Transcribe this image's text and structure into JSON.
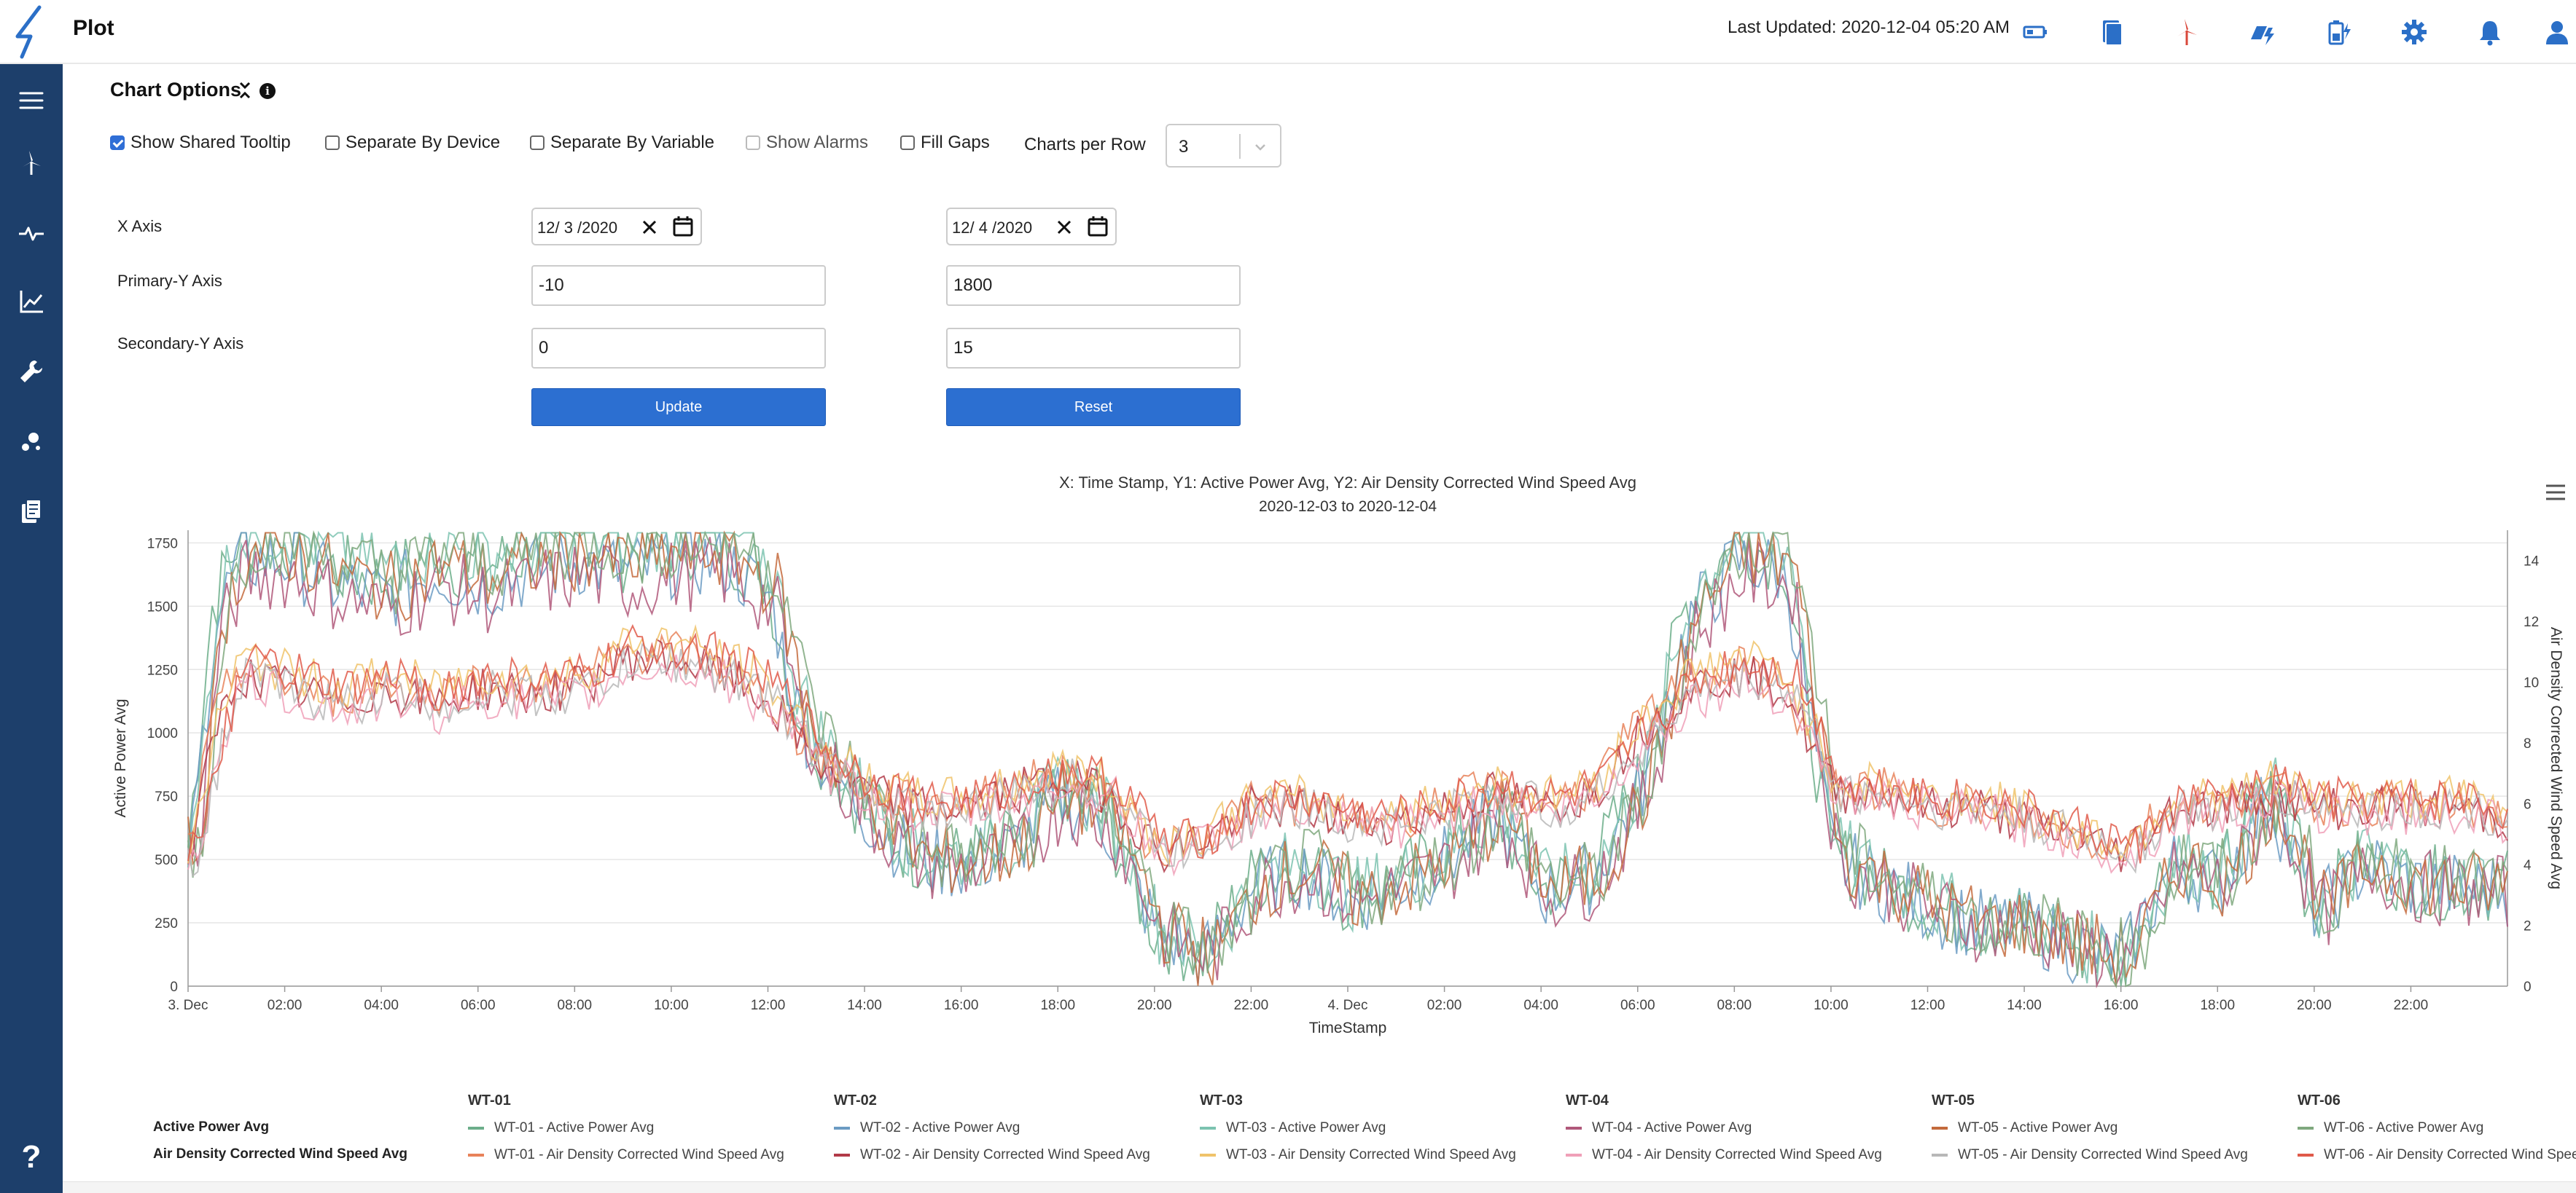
{
  "header": {
    "title": "Plot",
    "last_updated": "Last Updated: 2020-12-04 05:20 AM",
    "icons": [
      "battery-icon",
      "report-icon",
      "wind-turbine-icon",
      "solar-power-icon",
      "battery-charge-icon",
      "gear-icon",
      "bell-icon",
      "user-icon"
    ]
  },
  "sidebar": {
    "icons": [
      "menu-icon",
      "wind-turbine-icon",
      "pulse-icon",
      "line-chart-icon",
      "wrench-icon",
      "scatter-icon",
      "documents-icon"
    ],
    "help": "?"
  },
  "options": {
    "title": "Chart Options",
    "checkboxes": [
      {
        "label": "Show Shared Tooltip",
        "checked": true,
        "disabled": false
      },
      {
        "label": "Separate By Device",
        "checked": false,
        "disabled": false
      },
      {
        "label": "Separate By Variable",
        "checked": false,
        "disabled": false
      },
      {
        "label": "Show Alarms",
        "checked": false,
        "disabled": true
      },
      {
        "label": "Fill Gaps",
        "checked": false,
        "disabled": false
      }
    ],
    "charts_per_row_label": "Charts per Row",
    "charts_per_row_value": "3",
    "x_axis_label": "X Axis",
    "x_axis_start": "12/ 3 /2020",
    "x_axis_end": "12/ 4 /2020",
    "primary_y_label": "Primary-Y Axis",
    "primary_y_min": "-10",
    "primary_y_max": "1800",
    "secondary_y_label": "Secondary-Y Axis",
    "secondary_y_min": "0",
    "secondary_y_max": "15",
    "update_label": "Update",
    "reset_label": "Reset"
  },
  "chart_data": {
    "type": "line",
    "title": "X: Time Stamp, Y1: Active Power Avg, Y2: Air Density Corrected Wind Speed Avg",
    "subtitle": "2020-12-03 to 2020-12-04",
    "xlabel": "TimeStamp",
    "ylabel": "Active Power Avg",
    "y2label": "Air Density Corrected Wind Speed Avg",
    "x_ticks": [
      "3. Dec",
      "02:00",
      "04:00",
      "06:00",
      "08:00",
      "10:00",
      "12:00",
      "14:00",
      "16:00",
      "18:00",
      "20:00",
      "22:00",
      "4. Dec",
      "02:00",
      "04:00",
      "06:00",
      "08:00",
      "10:00",
      "12:00",
      "14:00",
      "16:00",
      "18:00",
      "20:00",
      "22:00"
    ],
    "x_range_hours": [
      0,
      48
    ],
    "ylim": [
      0,
      1800
    ],
    "y_ticks": [
      0,
      250,
      500,
      750,
      1000,
      1250,
      1500,
      1750
    ],
    "y2lim": [
      0,
      15
    ],
    "y2_ticks": [
      0,
      2,
      4,
      6,
      8,
      10,
      12,
      14
    ],
    "grid": true,
    "hours": [
      0,
      0.5,
      1,
      2,
      3,
      4,
      5,
      6,
      7,
      8,
      9,
      10,
      11,
      12,
      12.5,
      13,
      14,
      15,
      16,
      17,
      18,
      19,
      20,
      21,
      22,
      23,
      24,
      25,
      26,
      27,
      28,
      29,
      30,
      31,
      32,
      33,
      34,
      35,
      36,
      37,
      38,
      39,
      40,
      41,
      42,
      43,
      44,
      45,
      46,
      47,
      48
    ],
    "power_profile": [
      550,
      1500,
      1750,
      1750,
      1650,
      1600,
      1700,
      1650,
      1700,
      1750,
      1700,
      1750,
      1750,
      1600,
      1150,
      950,
      700,
      520,
      500,
      560,
      780,
      650,
      220,
      120,
      420,
      480,
      350,
      420,
      520,
      700,
      380,
      450,
      800,
      1500,
      1750,
      1700,
      520,
      420,
      320,
      250,
      250,
      160,
      110,
      500,
      420,
      780,
      300,
      500,
      420,
      400,
      400
    ],
    "wind_profile": [
      4.5,
      8.5,
      10.5,
      10,
      9.5,
      10,
      9.5,
      10,
      9.8,
      10,
      11,
      11,
      10.5,
      9.5,
      8.5,
      7.5,
      6.5,
      6,
      6,
      6.5,
      7,
      6.5,
      4.5,
      5,
      6,
      6,
      5.5,
      5.5,
      6,
      6.5,
      6,
      6.5,
      8.5,
      10,
      10.5,
      10,
      6.5,
      6.5,
      6,
      6,
      5.5,
      5,
      4.5,
      6,
      6,
      6.5,
      6,
      6,
      6,
      6,
      5.5
    ],
    "series": [
      {
        "group": "WT-01",
        "name": "WT-01 - Active Power Avg",
        "axis": "y1",
        "color": "#6cae8a",
        "scale": 1.0
      },
      {
        "group": "WT-02",
        "name": "WT-02 - Active Power Avg",
        "axis": "y1",
        "color": "#6b9bc3",
        "scale": 0.96
      },
      {
        "group": "WT-03",
        "name": "WT-03 - Active Power Avg",
        "axis": "y1",
        "color": "#7cc3b0",
        "scale": 1.03
      },
      {
        "group": "WT-04",
        "name": "WT-04 - Active Power Avg",
        "axis": "y1",
        "color": "#b0587a",
        "scale": 0.93
      },
      {
        "group": "WT-05",
        "name": "WT-05 - Active Power Avg",
        "axis": "y1",
        "color": "#c46a3c",
        "scale": 0.98
      },
      {
        "group": "WT-06",
        "name": "WT-06 - Active Power Avg",
        "axis": "y1",
        "color": "#7fa87e",
        "scale": 1.01
      },
      {
        "group": "WT-01",
        "name": "WT-01 - Air Density Corrected Wind Speed Avg",
        "axis": "y2",
        "color": "#e8825a",
        "scale": 1.0
      },
      {
        "group": "WT-02",
        "name": "WT-02 - Air Density Corrected Wind Speed Avg",
        "axis": "y2",
        "color": "#b23a48",
        "scale": 0.98
      },
      {
        "group": "WT-03",
        "name": "WT-03 - Air Density Corrected Wind Speed Avg",
        "axis": "y2",
        "color": "#f0c36a",
        "scale": 1.03
      },
      {
        "group": "WT-04",
        "name": "WT-04 - Air Density Corrected Wind Speed Avg",
        "axis": "y2",
        "color": "#f0a0b8",
        "scale": 0.95
      },
      {
        "group": "WT-05",
        "name": "WT-05 - Air Density Corrected Wind Speed Avg",
        "axis": "y2",
        "color": "#b8b8b8",
        "scale": 0.97
      },
      {
        "group": "WT-06",
        "name": "WT-06 - Air Density Corrected Wind Speed Avg",
        "axis": "y2",
        "color": "#e05a4a",
        "scale": 1.02
      }
    ]
  },
  "legend": {
    "groups": [
      "WT-01",
      "WT-02",
      "WT-03",
      "WT-04",
      "WT-05",
      "WT-06"
    ],
    "row_labels": [
      "Active Power Avg",
      "Air Density Corrected Wind Speed Avg"
    ]
  }
}
